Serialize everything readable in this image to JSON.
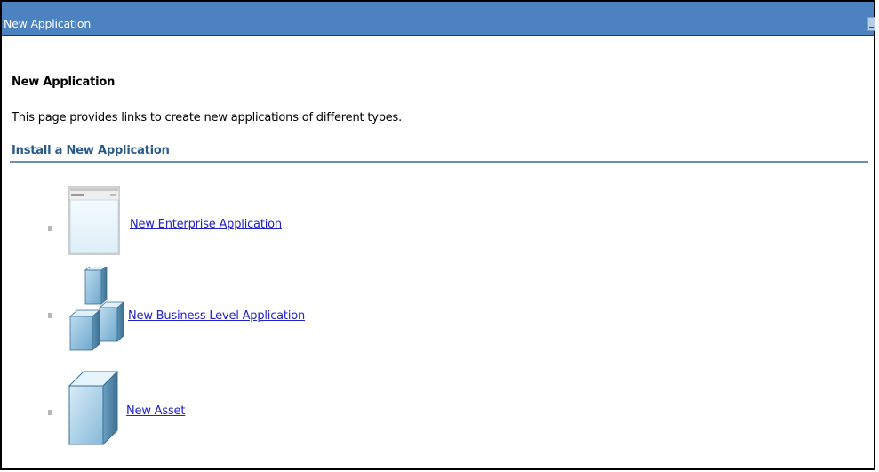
{
  "window": {
    "title": "New Application"
  },
  "page": {
    "heading": "New Application",
    "description": "This page provides links to create new applications of different types.",
    "section_title": "Install a New Application"
  },
  "items": [
    {
      "label": "New Enterprise Application",
      "icon": "enterprise-application-icon"
    },
    {
      "label": "New Business Level Application",
      "icon": "business-level-application-icon"
    },
    {
      "label": "New Asset",
      "icon": "asset-icon"
    }
  ],
  "colors": {
    "titlebar": "#4d82c0",
    "section_title": "#2a5a8a",
    "link": "#2222cc"
  }
}
